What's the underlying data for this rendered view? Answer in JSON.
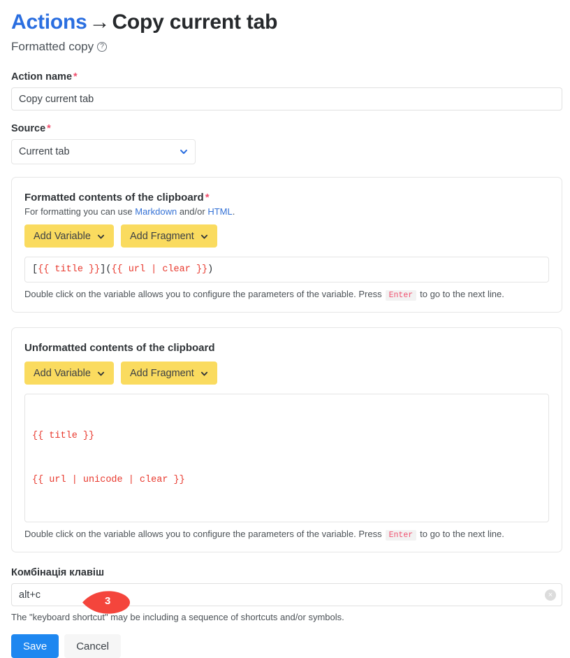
{
  "header": {
    "breadcrumb_link": "Actions",
    "breadcrumb_arrow": "→",
    "breadcrumb_current": "Copy current tab",
    "subtitle": "Formatted copy",
    "help_icon": "question-mark-circle"
  },
  "action_name": {
    "label": "Action name",
    "required_mark": "*",
    "value": "Copy current tab",
    "placeholder": "Action name"
  },
  "source": {
    "label": "Source",
    "required_mark": "*",
    "selected": "Current tab"
  },
  "formatted_card": {
    "title": "Formatted contents of the clipboard",
    "required_mark": "*",
    "sub_prefix": "For formatting you can use ",
    "sub_link1": "Markdown",
    "sub_middle": " and/or ",
    "sub_link2": "HTML",
    "sub_suffix": ".",
    "add_variable": "Add Variable",
    "add_fragment": "Add Fragment",
    "code_plain_1": "[",
    "code_var_1": "{{ title }}",
    "code_plain_2": "](",
    "code_var_2": "{{ url | clear }}",
    "code_plain_3": ")",
    "hint_before": "Double click on the variable allows you to configure the parameters of the variable. Press",
    "hint_key": "Enter",
    "hint_after": "to go to the next line."
  },
  "unformatted_card": {
    "title": "Unformatted contents of the clipboard",
    "add_variable": "Add Variable",
    "add_fragment": "Add Fragment",
    "code_line_1": "{{ title }}",
    "code_line_2": "{{ url | unicode | clear }}",
    "hint_before": "Double click on the variable allows you to configure the parameters of the variable. Press",
    "hint_key": "Enter",
    "hint_after": "to go to the next line."
  },
  "shortcut": {
    "label": "Комбінація клавіш",
    "value": "alt+c",
    "placeholder": "alt+c",
    "clear_icon": "×",
    "marker_number": "3",
    "helper": "The \"keyboard shortcut\" may be including a sequence of shortcuts and/or symbols."
  },
  "footer": {
    "save": "Save",
    "cancel": "Cancel"
  },
  "colors": {
    "link": "#2a6ee0",
    "accent_yellow": "#fadb5f",
    "primary_blue": "#1e87f0",
    "required_red": "#f0506e",
    "marker_red": "#f4453c",
    "code_red": "#e8392e"
  }
}
